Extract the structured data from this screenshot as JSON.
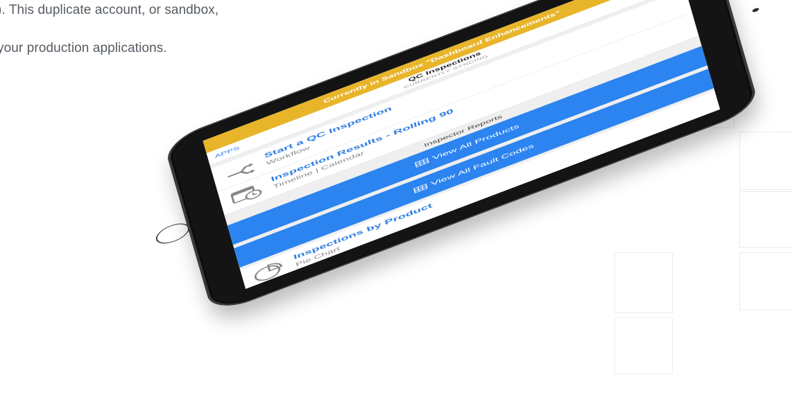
{
  "background": {
    "line1": "). This duplicate account, or sandbox,",
    "line2": "your production applications."
  },
  "tablet": {
    "sandbox_banner": "Currently in Sandbox \"Dashboard Enhancements\"",
    "top_icons": [
      "refresh-icon",
      "search-icon",
      "gear-icon"
    ],
    "apps_label": "APPS",
    "page_title": "QC Inspections",
    "page_subtitle": "CURRENTLY SYNCING",
    "rows": [
      {
        "title": "Start a QC Inspection",
        "subtitle": "Workflow",
        "icon": "workflow-arrows-icon"
      },
      {
        "title": "Inspection Results - Rolling 90",
        "subtitle": "Timeline | Calendar",
        "icon": "calendar-clock-icon"
      }
    ],
    "section_label": "Inspector Reports",
    "buttons": [
      {
        "label": "View All Products",
        "icon": "grid-table-icon"
      },
      {
        "label": "View All Fault Codes",
        "icon": "grid-table-icon"
      }
    ],
    "bottom_row": {
      "title": "Inspections by Product",
      "subtitle": "Pie Chart",
      "icon": "pie-chart-icon"
    },
    "colors": {
      "accent_yellow": "#e8b52a",
      "accent_blue": "#2b84f0",
      "link_blue": "#2f7de1",
      "bezel": "#141414"
    }
  }
}
